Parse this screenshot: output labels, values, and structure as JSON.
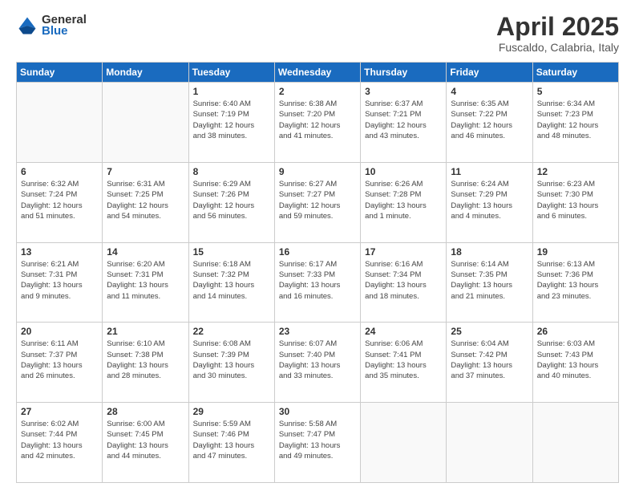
{
  "logo": {
    "general": "General",
    "blue": "Blue"
  },
  "title": "April 2025",
  "subtitle": "Fuscaldo, Calabria, Italy",
  "days_of_week": [
    "Sunday",
    "Monday",
    "Tuesday",
    "Wednesday",
    "Thursday",
    "Friday",
    "Saturday"
  ],
  "weeks": [
    [
      {
        "day": "",
        "info": ""
      },
      {
        "day": "",
        "info": ""
      },
      {
        "day": "1",
        "info": "Sunrise: 6:40 AM\nSunset: 7:19 PM\nDaylight: 12 hours\nand 38 minutes."
      },
      {
        "day": "2",
        "info": "Sunrise: 6:38 AM\nSunset: 7:20 PM\nDaylight: 12 hours\nand 41 minutes."
      },
      {
        "day": "3",
        "info": "Sunrise: 6:37 AM\nSunset: 7:21 PM\nDaylight: 12 hours\nand 43 minutes."
      },
      {
        "day": "4",
        "info": "Sunrise: 6:35 AM\nSunset: 7:22 PM\nDaylight: 12 hours\nand 46 minutes."
      },
      {
        "day": "5",
        "info": "Sunrise: 6:34 AM\nSunset: 7:23 PM\nDaylight: 12 hours\nand 48 minutes."
      }
    ],
    [
      {
        "day": "6",
        "info": "Sunrise: 6:32 AM\nSunset: 7:24 PM\nDaylight: 12 hours\nand 51 minutes."
      },
      {
        "day": "7",
        "info": "Sunrise: 6:31 AM\nSunset: 7:25 PM\nDaylight: 12 hours\nand 54 minutes."
      },
      {
        "day": "8",
        "info": "Sunrise: 6:29 AM\nSunset: 7:26 PM\nDaylight: 12 hours\nand 56 minutes."
      },
      {
        "day": "9",
        "info": "Sunrise: 6:27 AM\nSunset: 7:27 PM\nDaylight: 12 hours\nand 59 minutes."
      },
      {
        "day": "10",
        "info": "Sunrise: 6:26 AM\nSunset: 7:28 PM\nDaylight: 13 hours\nand 1 minute."
      },
      {
        "day": "11",
        "info": "Sunrise: 6:24 AM\nSunset: 7:29 PM\nDaylight: 13 hours\nand 4 minutes."
      },
      {
        "day": "12",
        "info": "Sunrise: 6:23 AM\nSunset: 7:30 PM\nDaylight: 13 hours\nand 6 minutes."
      }
    ],
    [
      {
        "day": "13",
        "info": "Sunrise: 6:21 AM\nSunset: 7:31 PM\nDaylight: 13 hours\nand 9 minutes."
      },
      {
        "day": "14",
        "info": "Sunrise: 6:20 AM\nSunset: 7:31 PM\nDaylight: 13 hours\nand 11 minutes."
      },
      {
        "day": "15",
        "info": "Sunrise: 6:18 AM\nSunset: 7:32 PM\nDaylight: 13 hours\nand 14 minutes."
      },
      {
        "day": "16",
        "info": "Sunrise: 6:17 AM\nSunset: 7:33 PM\nDaylight: 13 hours\nand 16 minutes."
      },
      {
        "day": "17",
        "info": "Sunrise: 6:16 AM\nSunset: 7:34 PM\nDaylight: 13 hours\nand 18 minutes."
      },
      {
        "day": "18",
        "info": "Sunrise: 6:14 AM\nSunset: 7:35 PM\nDaylight: 13 hours\nand 21 minutes."
      },
      {
        "day": "19",
        "info": "Sunrise: 6:13 AM\nSunset: 7:36 PM\nDaylight: 13 hours\nand 23 minutes."
      }
    ],
    [
      {
        "day": "20",
        "info": "Sunrise: 6:11 AM\nSunset: 7:37 PM\nDaylight: 13 hours\nand 26 minutes."
      },
      {
        "day": "21",
        "info": "Sunrise: 6:10 AM\nSunset: 7:38 PM\nDaylight: 13 hours\nand 28 minutes."
      },
      {
        "day": "22",
        "info": "Sunrise: 6:08 AM\nSunset: 7:39 PM\nDaylight: 13 hours\nand 30 minutes."
      },
      {
        "day": "23",
        "info": "Sunrise: 6:07 AM\nSunset: 7:40 PM\nDaylight: 13 hours\nand 33 minutes."
      },
      {
        "day": "24",
        "info": "Sunrise: 6:06 AM\nSunset: 7:41 PM\nDaylight: 13 hours\nand 35 minutes."
      },
      {
        "day": "25",
        "info": "Sunrise: 6:04 AM\nSunset: 7:42 PM\nDaylight: 13 hours\nand 37 minutes."
      },
      {
        "day": "26",
        "info": "Sunrise: 6:03 AM\nSunset: 7:43 PM\nDaylight: 13 hours\nand 40 minutes."
      }
    ],
    [
      {
        "day": "27",
        "info": "Sunrise: 6:02 AM\nSunset: 7:44 PM\nDaylight: 13 hours\nand 42 minutes."
      },
      {
        "day": "28",
        "info": "Sunrise: 6:00 AM\nSunset: 7:45 PM\nDaylight: 13 hours\nand 44 minutes."
      },
      {
        "day": "29",
        "info": "Sunrise: 5:59 AM\nSunset: 7:46 PM\nDaylight: 13 hours\nand 47 minutes."
      },
      {
        "day": "30",
        "info": "Sunrise: 5:58 AM\nSunset: 7:47 PM\nDaylight: 13 hours\nand 49 minutes."
      },
      {
        "day": "",
        "info": ""
      },
      {
        "day": "",
        "info": ""
      },
      {
        "day": "",
        "info": ""
      }
    ]
  ]
}
